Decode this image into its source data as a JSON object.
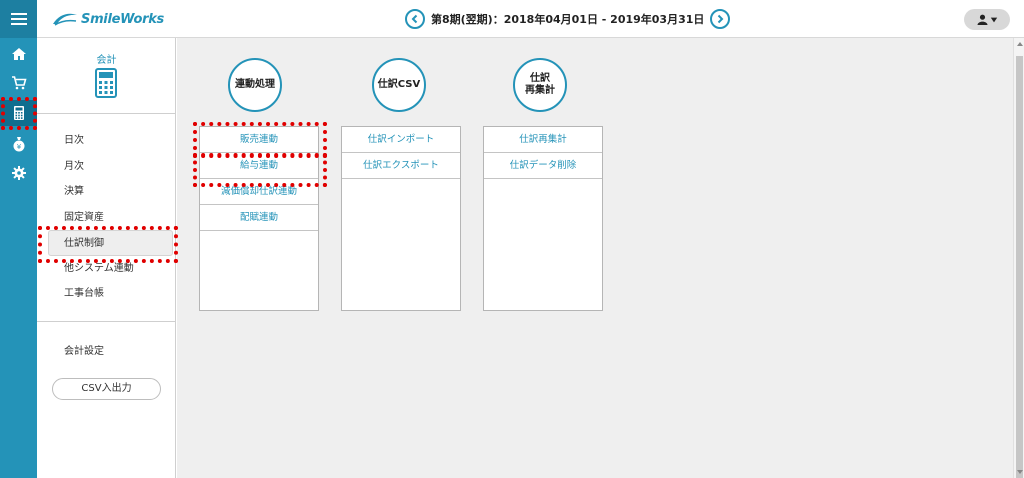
{
  "app": {
    "logo_text": "SmileWorks",
    "period_text": "第8期(翌期)：2018年04月01日 - 2019年03月31日"
  },
  "menu": {
    "title": "会計",
    "items": [
      {
        "label": "日次"
      },
      {
        "label": "月次"
      },
      {
        "label": "決算"
      },
      {
        "label": "固定資産"
      },
      {
        "label": "仕訳制御"
      },
      {
        "label": "他システム連動"
      },
      {
        "label": "工事台帳"
      }
    ],
    "setting_label": "会計設定",
    "csv_button_label": "CSV入出力"
  },
  "groups": [
    {
      "circle_label": "連動処理",
      "items": [
        "販売連動",
        "給与連動",
        "減価償却仕訳連動",
        "配賦連動"
      ]
    },
    {
      "circle_label": "仕訳CSV",
      "items": [
        "仕訳インポート",
        "仕訳エクスポート"
      ]
    },
    {
      "circle_label_line1": "仕訳",
      "circle_label_line2": "再集計",
      "items": [
        "仕訳再集計",
        "仕訳データ削除"
      ]
    }
  ],
  "colors": {
    "accent": "#2493b8",
    "highlight": "#e00000"
  }
}
